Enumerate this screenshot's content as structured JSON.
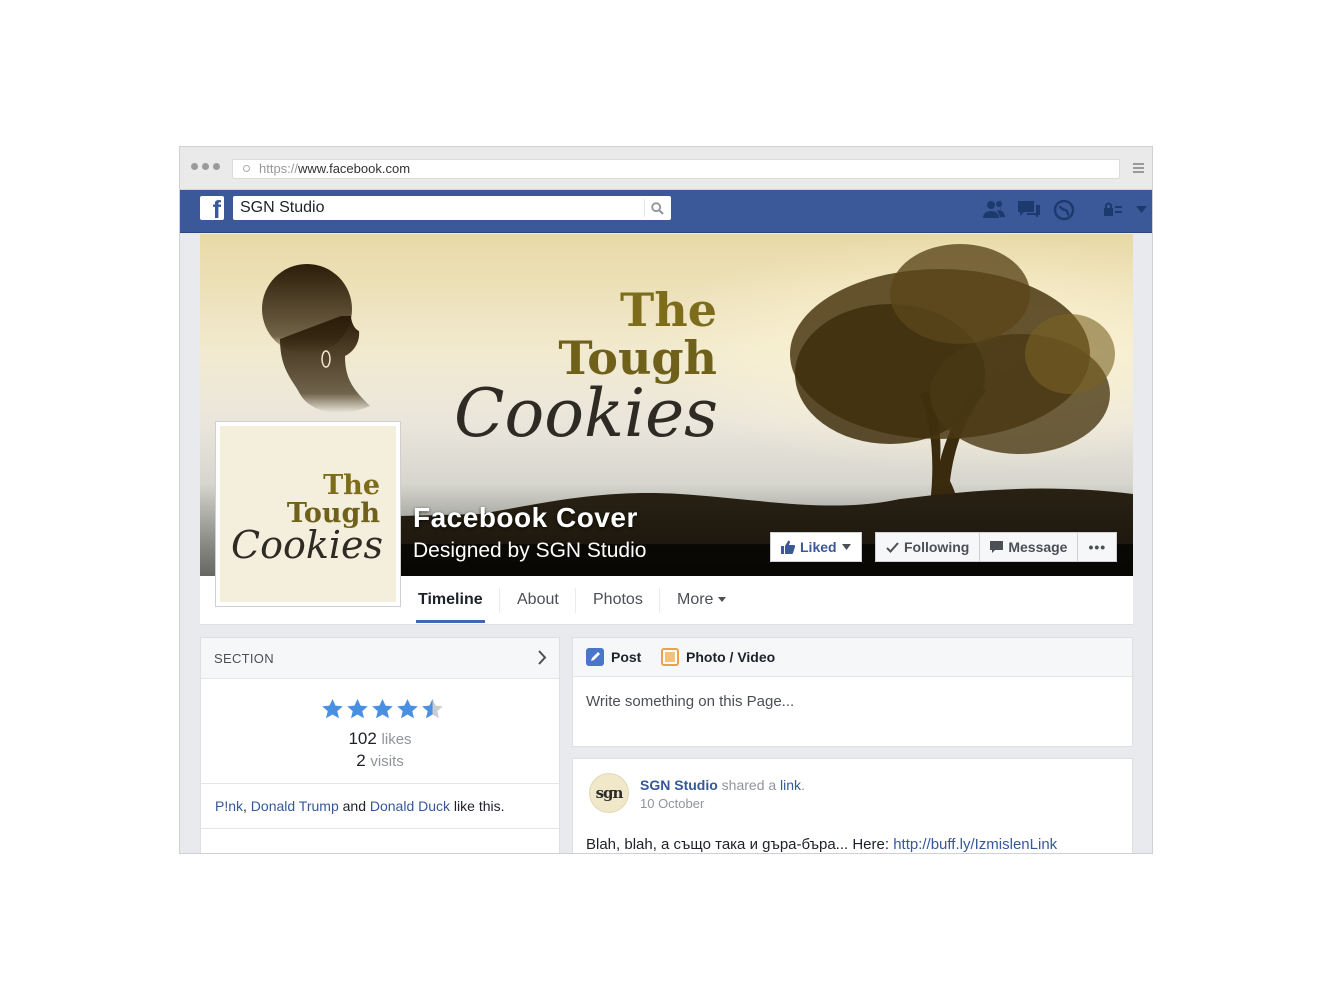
{
  "browser": {
    "url_prefix": "https://",
    "url_rest": "www.facebook.com"
  },
  "topbar": {
    "search_value": "SGN Studio"
  },
  "cover": {
    "brand_line1": "The",
    "brand_line2": "Tough",
    "brand_line3": "Cookies",
    "title": "Facebook Cover",
    "subtitle": "Designed by SGN Studio",
    "buttons": {
      "liked": "Liked",
      "following": "Following",
      "message": "Message",
      "more": "•••"
    }
  },
  "profile": {
    "brand_line1": "The",
    "brand_line2": "Tough",
    "brand_line3": "Cookies"
  },
  "tabs": [
    {
      "label": "Timeline",
      "active": true
    },
    {
      "label": "About"
    },
    {
      "label": "Photos"
    },
    {
      "label": "More"
    }
  ],
  "section": {
    "title": "SECTION",
    "rating": 4.5,
    "likes_count": "102",
    "likes_label": "likes",
    "visits_count": "2",
    "visits_label": "visits",
    "likers": {
      "name1": "P!nk",
      "sep1": ", ",
      "name2": "Donald Trump",
      "and": " and ",
      "name3": "Donald Duck",
      "suffix": " like this."
    }
  },
  "composer": {
    "post_tab": "Post",
    "photo_tab": "Photo / Video",
    "placeholder": "Write something on this Page..."
  },
  "post": {
    "avatar_text": "sgn",
    "author": "SGN Studio",
    "action": " shared a ",
    "object": "link",
    "period": ".",
    "date": "10 October",
    "text": "Blah, blah, а също така и gъра-бъра... Here: ",
    "link": "http://buff.ly/IzmislenLink"
  },
  "colors": {
    "facebook_blue": "#3b5998",
    "link_blue": "#365899",
    "star_blue": "#4a90e2",
    "brand_olive": "#8a7a1e"
  }
}
